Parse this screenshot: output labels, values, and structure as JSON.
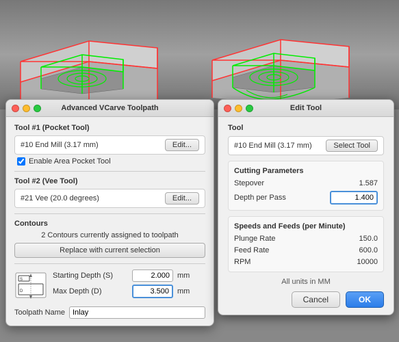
{
  "viewport": {
    "description": "3D CNC toolpath visualization"
  },
  "left_dialog": {
    "title": "Advanced VCarve Toolpath",
    "tool1": {
      "section_label": "Tool #1 (Pocket Tool)",
      "name": "#10 End Mill (3.17 mm)",
      "edit_button": "Edit..."
    },
    "enable_area_pocket": {
      "checked": true,
      "label": "Enable Area Pocket Tool"
    },
    "tool2": {
      "section_label": "Tool #2 (Vee Tool)",
      "name": "#21 Vee (20.0 degrees)",
      "edit_button": "Edit..."
    },
    "contours": {
      "section_label": "Contours",
      "count_text": "2 Contours currently assigned to toolpath",
      "replace_button": "Replace with current selection"
    },
    "starting_depth": {
      "label": "Starting Depth (S)",
      "value": "2.000",
      "unit": "mm"
    },
    "max_depth": {
      "label": "Max Depth (D)",
      "value": "3.500",
      "unit": "mm"
    },
    "toolpath_name": {
      "label": "Toolpath Name",
      "value": "Inlay"
    }
  },
  "right_dialog": {
    "title": "Edit Tool",
    "tool_section_label": "Tool",
    "tool_name": "#10 End Mill (3.17 mm)",
    "select_tool_button": "Select Tool",
    "cutting_params": {
      "section_label": "Cutting Parameters",
      "stepover_label": "Stepover",
      "stepover_value": "1.587",
      "depth_per_pass_label": "Depth per Pass",
      "depth_per_pass_value": "1.400"
    },
    "speeds_feeds": {
      "section_label": "Speeds and Feeds (per Minute)",
      "plunge_rate_label": "Plunge Rate",
      "plunge_rate_value": "150.0",
      "feed_rate_label": "Feed Rate",
      "feed_rate_value": "600.0",
      "rpm_label": "RPM",
      "rpm_value": "10000"
    },
    "units_note": "All units in MM",
    "cancel_button": "Cancel",
    "ok_button": "OK"
  }
}
